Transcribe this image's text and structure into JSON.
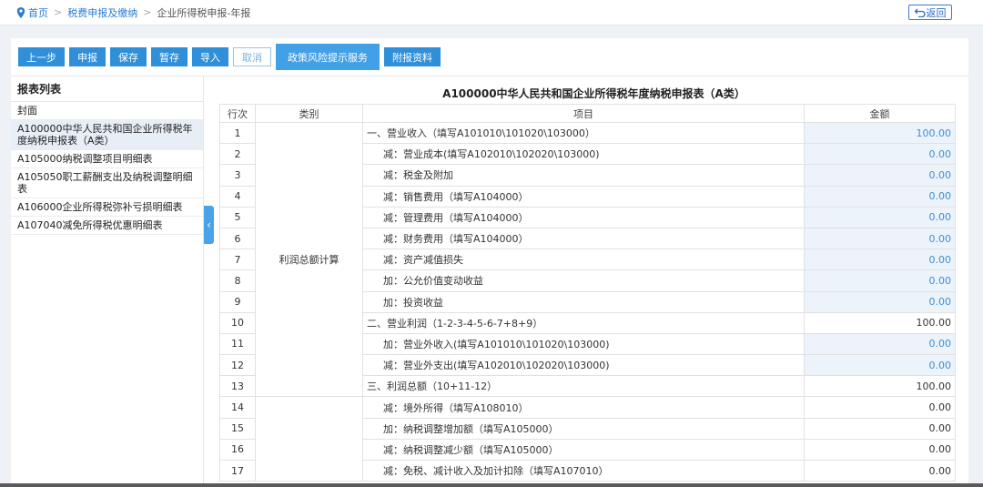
{
  "breadcrumb": {
    "home": "首页",
    "level2": "税费申报及缴纳",
    "current": "企业所得税申报-年报",
    "separator": ">"
  },
  "back_button": "返回",
  "toolbar": {
    "prev": "上一步",
    "declare": "申报",
    "save": "保存",
    "temp_save": "暂存",
    "import": "导入",
    "cancel": "取消",
    "policy_risk": "政策风险提示服务",
    "attachments": "附报资料"
  },
  "sidebar": {
    "title": "报表列表",
    "items": [
      "封面",
      "A100000中华人民共和国企业所得税年度纳税申报表（A类）",
      "A105000纳税调整项目明细表",
      "A105050职工薪酬支出及纳税调整明细表",
      "A106000企业所得税弥补亏损明细表",
      "A107040减免所得税优惠明细表"
    ]
  },
  "form": {
    "title": "A100000中华人民共和国企业所得税年度纳税申报表（A类）",
    "headers": {
      "row": "行次",
      "category": "类别",
      "item": "项目",
      "amount": "金额"
    },
    "category_profit": "利润总额计算",
    "rows": [
      {
        "n": "1",
        "item": "一、营业收入（填写A101010\\101020\\103000）",
        "amount": "100.00",
        "editable": true,
        "indent": false
      },
      {
        "n": "2",
        "item": "减：营业成本(填写A102010\\102020\\103000)",
        "amount": "0.00",
        "editable": true,
        "indent": true
      },
      {
        "n": "3",
        "item": "减：税金及附加",
        "amount": "0.00",
        "editable": true,
        "indent": true
      },
      {
        "n": "4",
        "item": "减：销售费用（填写A104000）",
        "amount": "0.00",
        "editable": true,
        "indent": true
      },
      {
        "n": "5",
        "item": "减：管理费用（填写A104000）",
        "amount": "0.00",
        "editable": true,
        "indent": true
      },
      {
        "n": "6",
        "item": "减：财务费用（填写A104000）",
        "amount": "0.00",
        "editable": true,
        "indent": true
      },
      {
        "n": "7",
        "item": "减：资产减值损失",
        "amount": "0.00",
        "editable": true,
        "indent": true
      },
      {
        "n": "8",
        "item": "加：公允价值变动收益",
        "amount": "0.00",
        "editable": true,
        "indent": true
      },
      {
        "n": "9",
        "item": "加：投资收益",
        "amount": "0.00",
        "editable": true,
        "indent": true
      },
      {
        "n": "10",
        "item": "二、营业利润（1-2-3-4-5-6-7+8+9）",
        "amount": "100.00",
        "editable": false,
        "indent": false
      },
      {
        "n": "11",
        "item": "加：营业外收入(填写A101010\\101020\\103000)",
        "amount": "0.00",
        "editable": true,
        "indent": true
      },
      {
        "n": "12",
        "item": "减：营业外支出(填写A102010\\102020\\103000)",
        "amount": "0.00",
        "editable": true,
        "indent": true
      },
      {
        "n": "13",
        "item": "三、利润总额（10+11-12）",
        "amount": "100.00",
        "editable": false,
        "indent": false
      },
      {
        "n": "14",
        "item": "减：境外所得（填写A108010）",
        "amount": "0.00",
        "editable": false,
        "indent": true
      },
      {
        "n": "15",
        "item": "加：纳税调整增加额（填写A105000）",
        "amount": "0.00",
        "editable": false,
        "indent": true
      },
      {
        "n": "16",
        "item": "减：纳税调整减少额（填写A105000）",
        "amount": "0.00",
        "editable": false,
        "indent": true
      },
      {
        "n": "17",
        "item": "减：免税、减计收入及加计扣除（填写A107010）",
        "amount": "0.00",
        "editable": false,
        "indent": true
      }
    ]
  },
  "colors": {
    "primary_button": "#2f8fd8",
    "link": "#2a7bd1",
    "editable_cell_bg": "#ecf3fb",
    "editable_value": "#3a8fd8"
  },
  "icons": {
    "home": "location-pin-icon",
    "back": "return-arrow-icon",
    "collapse": "chevron-left-icon"
  }
}
